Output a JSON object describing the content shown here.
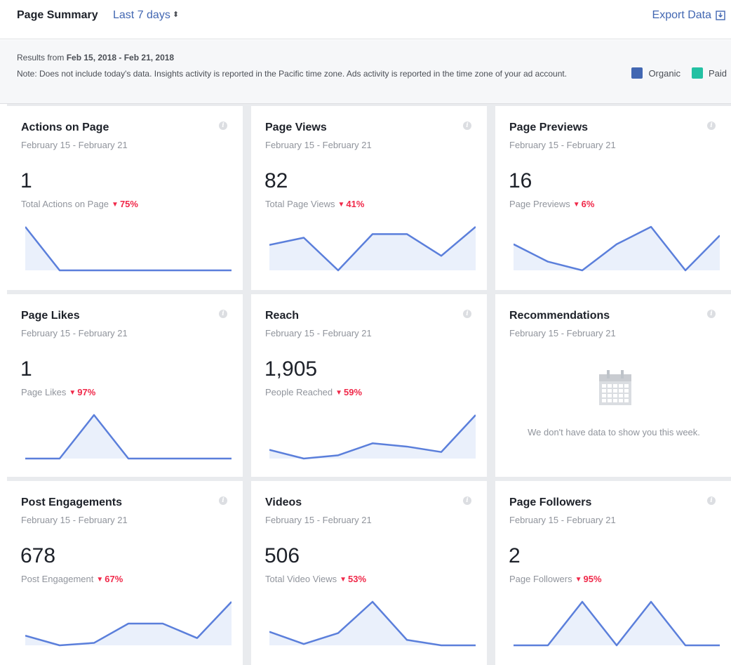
{
  "header": {
    "title": "Page Summary",
    "range": "Last 7 days",
    "export_label": "Export Data"
  },
  "info": {
    "results_prefix": "Results from ",
    "results_range": "Feb 15, 2018 - Feb 21, 2018",
    "note": "Note: Does not include today's data. Insights activity is reported in the Pacific time zone. Ads activity is reported in the time zone of your ad account.",
    "legend": [
      {
        "label": "Organic",
        "color": "#4267b2"
      },
      {
        "label": "Paid",
        "color": "#23c1a3"
      }
    ]
  },
  "colors": {
    "accent": "#4267b2",
    "line": "#5b7fdb",
    "area": "#eaf0fb",
    "decrease": "#f02849"
  },
  "cards": [
    {
      "title": "Actions on Page",
      "date": "February 15 - February 21",
      "value": "1",
      "label": "Total Actions on Page",
      "change": "75%",
      "spark": [
        6,
        1,
        1,
        1,
        1,
        1,
        1
      ]
    },
    {
      "title": "Page Views",
      "date": "February 15 - February 21",
      "value": "82",
      "label": "Total Page Views",
      "change": "41%",
      "spark": [
        13,
        15,
        6,
        16,
        16,
        10,
        18
      ]
    },
    {
      "title": "Page Previews",
      "date": "February 15 - February 21",
      "value": "16",
      "label": "Page Previews",
      "change": "6%",
      "spark": [
        3,
        1,
        0,
        3,
        5,
        0,
        4
      ]
    },
    {
      "title": "Page Likes",
      "date": "February 15 - February 21",
      "value": "1",
      "label": "Page Likes",
      "change": "97%",
      "spark": [
        0,
        0,
        1,
        0,
        0,
        0,
        0
      ]
    },
    {
      "title": "Reach",
      "date": "February 15 - February 21",
      "value": "1,905",
      "label": "People Reached",
      "change": "59%",
      "spark": [
        240,
        160,
        190,
        300,
        270,
        220,
        560
      ]
    },
    {
      "title": "Recommendations",
      "date": "February 15 - February 21",
      "empty_text": "We don't have data to show you this week."
    },
    {
      "title": "Post Engagements",
      "date": "February 15 - February 21",
      "value": "678",
      "label": "Post Engagement",
      "change": "67%",
      "spark": [
        60,
        20,
        30,
        110,
        110,
        50,
        200
      ]
    },
    {
      "title": "Videos",
      "date": "February 15 - February 21",
      "value": "506",
      "label": "Total Video Views",
      "change": "53%",
      "spark": [
        60,
        15,
        55,
        170,
        30,
        10,
        10
      ]
    },
    {
      "title": "Page Followers",
      "date": "February 15 - February 21",
      "value": "2",
      "label": "Page Followers",
      "change": "95%",
      "spark": [
        0,
        0,
        1,
        0,
        1,
        0,
        0
      ]
    }
  ]
}
